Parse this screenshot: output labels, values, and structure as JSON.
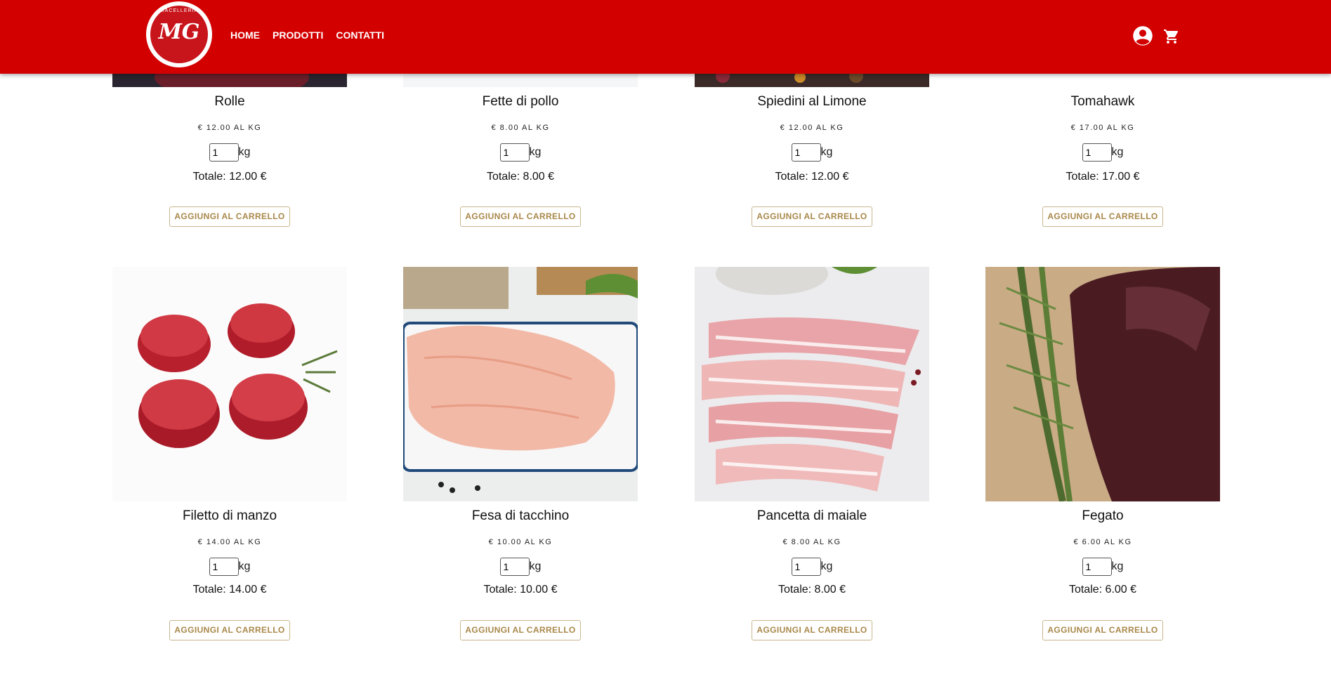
{
  "header": {
    "logo_text": "MACELLERIA",
    "logo_monogram": "MG",
    "nav": [
      {
        "label": "HOME"
      },
      {
        "label": "PRODOTTI"
      },
      {
        "label": "CONTATTI"
      }
    ],
    "icons": [
      "account-circle-icon",
      "shopping-cart-icon"
    ],
    "bg_color": "#d30000"
  },
  "unit_label": "kg",
  "products": [
    {
      "name": "Rolle",
      "price": "€ 12.00 AL KG",
      "qty": "1",
      "total": "Totale: 12.00 €",
      "button": "AGGIUNGI AL CARRELLO"
    },
    {
      "name": "Fette di pollo",
      "price": "€ 8.00 AL KG",
      "qty": "1",
      "total": "Totale: 8.00 €",
      "button": "AGGIUNGI AL CARRELLO"
    },
    {
      "name": "Spiedini al Limone",
      "price": "€ 12.00 AL KG",
      "qty": "1",
      "total": "Totale: 12.00 €",
      "button": "AGGIUNGI AL CARRELLO"
    },
    {
      "name": "Tomahawk",
      "price": "€ 17.00 AL KG",
      "qty": "1",
      "total": "Totale: 17.00 €",
      "button": "AGGIUNGI AL CARRELLO"
    },
    {
      "name": "Filetto di manzo",
      "price": "€ 14.00 AL KG",
      "qty": "1",
      "total": "Totale: 14.00 €",
      "button": "AGGIUNGI AL CARRELLO"
    },
    {
      "name": "Fesa di tacchino",
      "price": "€ 10.00 AL KG",
      "qty": "1",
      "total": "Totale: 10.00 €",
      "button": "AGGIUNGI AL CARRELLO"
    },
    {
      "name": "Pancetta di maiale",
      "price": "€ 8.00 AL KG",
      "qty": "1",
      "total": "Totale: 8.00 €",
      "button": "AGGIUNGI AL CARRELLO"
    },
    {
      "name": "Fegato",
      "price": "€ 6.00 AL KG",
      "qty": "1",
      "total": "Totale: 6.00 €",
      "button": "AGGIUNGI AL CARRELLO"
    }
  ]
}
